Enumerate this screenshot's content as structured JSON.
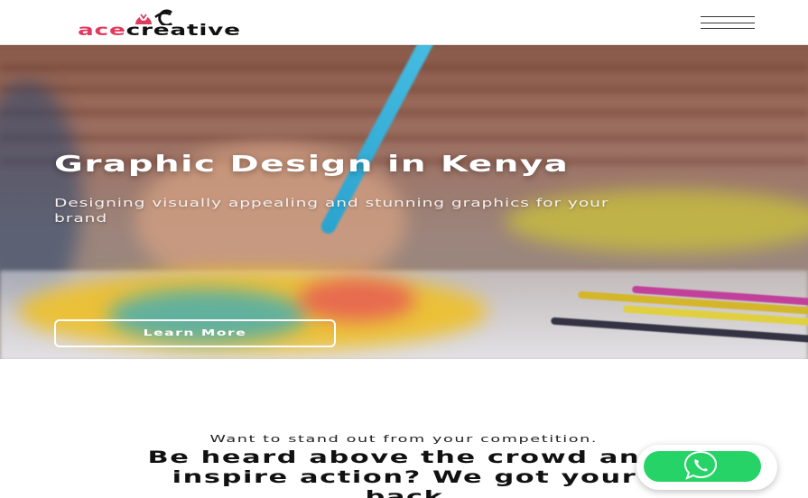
{
  "header": {
    "logo": {
      "part1": "ace",
      "part2": "creative"
    },
    "menu_icon": "hamburger-menu-icon"
  },
  "hero": {
    "title": "Graphic Design in Kenya",
    "subtitle": "Designing visually appealing and stunning graphics for your brand",
    "cta_label": "Learn More"
  },
  "section": {
    "tagline": "Want to stand out from your competition.",
    "headline": "Be heard above the crowd and inspire action? We got your back"
  },
  "floating": {
    "whatsapp_icon": "whatsapp-icon"
  },
  "colors": {
    "brand_accent": "#e23a5e",
    "whatsapp_green": "#25d366"
  }
}
